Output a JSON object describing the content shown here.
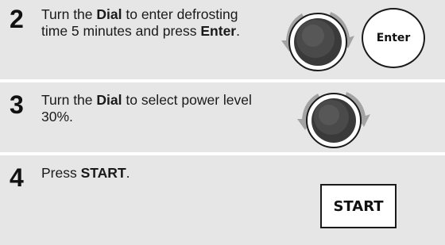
{
  "steps": [
    {
      "number": "2",
      "text_parts": [
        "Turn the ",
        "Dial",
        " to enter defrosting time 5 minutes and press ",
        "Enter",
        "."
      ],
      "button_label": "Enter"
    },
    {
      "number": "3",
      "text_parts": [
        "Turn the ",
        "Dial",
        " to select power level 30%."
      ]
    },
    {
      "number": "4",
      "text_parts": [
        "Press ",
        "START",
        "."
      ],
      "button_label": "START"
    }
  ],
  "icons": {
    "dial": "dial-knob-icon",
    "rotate_arrows": "rotate-arrows-icon"
  },
  "colors": {
    "panel_background": "#e6e6e6",
    "text": "#1a1a1a",
    "dial_dark": "#333333",
    "arrow_gray": "#9a9a9a"
  }
}
